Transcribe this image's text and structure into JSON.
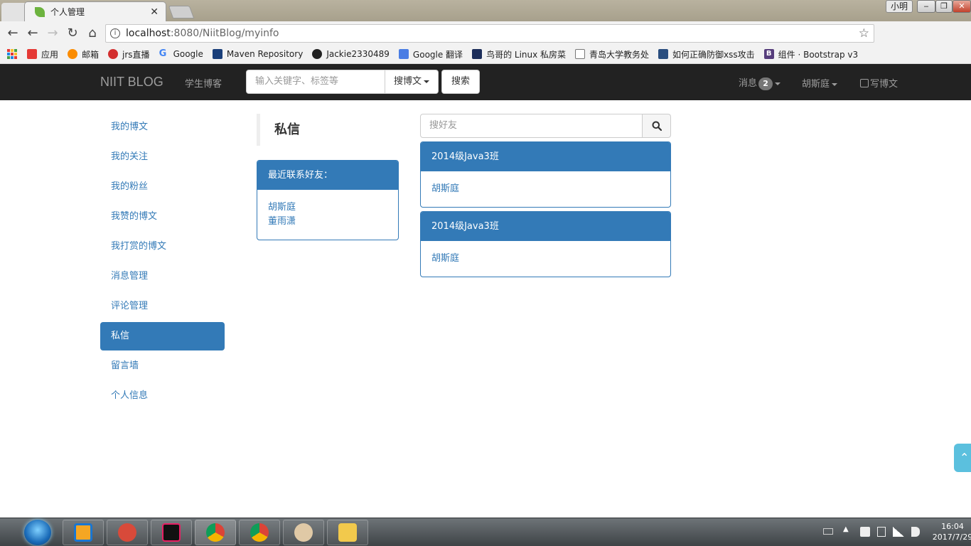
{
  "browser": {
    "tab_title": "个人管理",
    "url_host": "localhost",
    "url_path": ":8080/NiitBlog/myinfo",
    "window_user": "小明",
    "bookmarks": [
      "应用",
      "邮箱",
      "jrs直播",
      "Google",
      "Maven Repository",
      "Jackie2330489",
      "Google 翻译",
      "鸟哥的 Linux 私房菜",
      "青岛大学教务处",
      "如何正确防御xss攻击",
      "组件 · Bootstrap v3"
    ]
  },
  "navbar": {
    "brand": "NIIT BLOG",
    "student_blog": "学生博客",
    "search_placeholder": "输入关键字、标签等",
    "search_type": "搜博文",
    "search_button": "搜索",
    "messages_label": "消息",
    "messages_count": "2",
    "user_name": "胡斯庭",
    "write_label": "写博文"
  },
  "sidebar": {
    "items": [
      {
        "label": "我的博文"
      },
      {
        "label": "我的关注"
      },
      {
        "label": "我的粉丝"
      },
      {
        "label": "我赞的博文"
      },
      {
        "label": "我打赏的博文"
      },
      {
        "label": "消息管理"
      },
      {
        "label": "评论管理"
      },
      {
        "label": "私信"
      },
      {
        "label": "留言墙"
      },
      {
        "label": "个人信息"
      }
    ],
    "active_index": 7
  },
  "private_messages": {
    "title": "私信",
    "recent_heading": "最近联系好友：",
    "recent_contacts": [
      "胡斯庭",
      "董雨潇"
    ],
    "friend_search_placeholder": "搜好友",
    "groups": [
      {
        "name": "2014级Java3班",
        "member": "胡斯庭"
      },
      {
        "name": "2014级Java3班",
        "member": "胡斯庭"
      }
    ]
  },
  "taskbar": {
    "time": "16:04",
    "date": "2017/7/29"
  },
  "colors": {
    "primary": "#337ab7",
    "navbar_bg": "#222222",
    "navbar_text": "#9d9d9d",
    "back_to_top": "#5bc0de"
  }
}
